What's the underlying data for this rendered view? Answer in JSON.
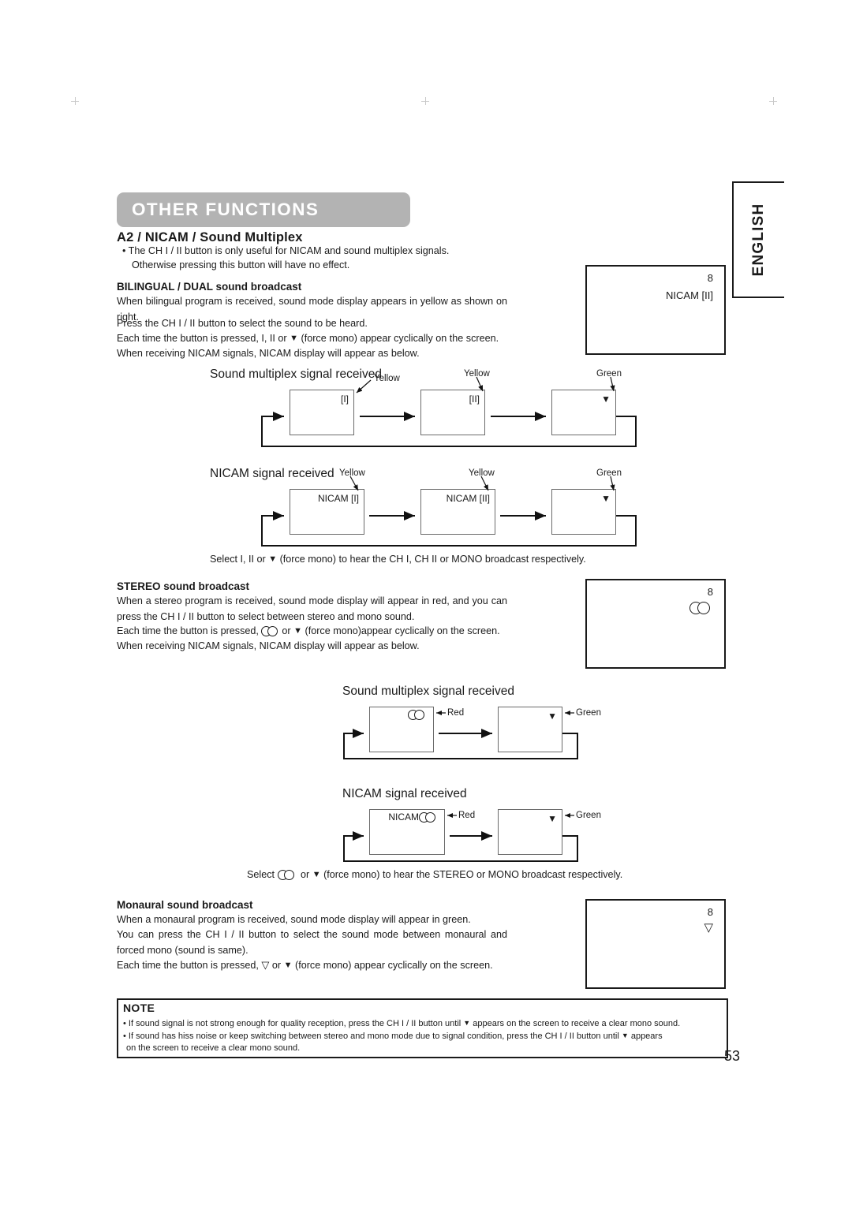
{
  "page": {
    "number": "53",
    "language_tab": "ENGLISH",
    "section_title": "OTHER FUNCTIONS"
  },
  "heading": {
    "main": "A2 / NICAM / Sound Multiplex",
    "bullet_line1": "• The CH I / II button is only useful for NICAM and sound multiplex signals.",
    "bullet_line2": "Otherwise pressing this button will have no effect."
  },
  "bilingual": {
    "title": "BILINGUAL / DUAL sound broadcast",
    "para1": "When bilingual program is received, sound mode display appears in yellow as shown on right.",
    "para2": "Press the CH I / II button to select the sound to be heard.",
    "para3_a": "Each time the button is pressed, I, II or",
    "para3_b": "(force mono) appear cyclically on the screen.",
    "para4": "When receiving NICAM signals, NICAM display will appear as below.",
    "tv_box": {
      "channel": "8",
      "mode": "NICAM [II]"
    },
    "select_a": "Select  I,  II or",
    "select_b": "(force mono) to hear the CH I, CH II or MONO broadcast respectively."
  },
  "stereo": {
    "title": "STEREO sound broadcast",
    "para1": "When a stereo program is received, sound mode display will appear in red, and you can press the CH I / II button to select between stereo and mono sound.",
    "para2_a": "Each time the button is pressed,",
    "para2_b": "or",
    "para2_c": "(force mono)appear cyclically on the screen.",
    "para3": "When receiving NICAM signals, NICAM display will appear as below.",
    "tv_box": {
      "channel": "8",
      "mode": "stereo-icon"
    },
    "select_a": "Select",
    "select_b": "or",
    "select_c": "(force mono) to hear the STEREO or MONO broadcast respectively."
  },
  "monaural": {
    "title": "Monaural sound broadcast",
    "para1": "When a monaural program is received, sound mode display will appear in green.",
    "para2": "You can press the CH I / II button to select the sound mode between monaural and forced mono (sound is same).",
    "para3_a": "Each time the button is pressed,",
    "para3_b": "or",
    "para3_c": "(force mono) appear cyclically on the screen.",
    "tv_box": {
      "channel": "8",
      "mode": "hollow-triangle-icon"
    }
  },
  "diagrams": [
    {
      "id": "bilingual-multiplex",
      "title": "Sound multiplex signal received",
      "boxes": [
        {
          "label": "[I]",
          "callout": "Yellow"
        },
        {
          "label": "[II]",
          "callout": "Yellow"
        },
        {
          "label": "▼",
          "callout": "Green"
        }
      ]
    },
    {
      "id": "bilingual-nicam",
      "title": "NICAM signal received",
      "boxes": [
        {
          "label": "NICAM [I]",
          "callout": "Yellow"
        },
        {
          "label": "NICAM [II]",
          "callout": "Yellow"
        },
        {
          "label": "▼",
          "callout": "Green"
        }
      ]
    },
    {
      "id": "stereo-multiplex",
      "title": "Sound multiplex signal received",
      "boxes": [
        {
          "label": "stereo-icon",
          "callout": "Red"
        },
        {
          "label": "▼",
          "callout": "Green"
        }
      ]
    },
    {
      "id": "stereo-nicam",
      "title": "NICAM signal received",
      "boxes": [
        {
          "label": "NICAM stereo-icon",
          "callout": "Red"
        },
        {
          "label": "▼",
          "callout": "Green"
        }
      ]
    }
  ],
  "note": {
    "title": "NOTE",
    "item1_a": "• If sound signal is not strong enough for quality reception, press the CH I / II button until",
    "item1_b": "appears on the screen to receive a clear mono sound.",
    "item2_a": "• If sound has hiss noise or keep switching between stereo and mono mode due to signal condition, press the CH I / II button until",
    "item2_b": "appears",
    "item2_c": "on the screen to receive a clear mono sound."
  }
}
